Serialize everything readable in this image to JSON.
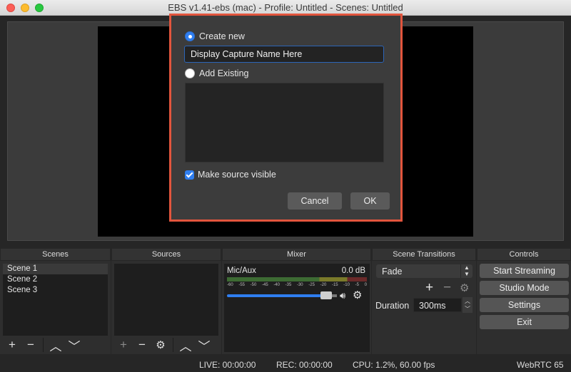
{
  "window": {
    "title": "EBS v1.41-ebs (mac) - Profile: Untitled - Scenes: Untitled"
  },
  "dialog": {
    "create_new_label": "Create new",
    "name_value": "Display Capture Name Here",
    "add_existing_label": "Add Existing",
    "make_visible_label": "Make source visible",
    "cancel_label": "Cancel",
    "ok_label": "OK"
  },
  "docks": {
    "scenes": "Scenes",
    "sources": "Sources",
    "mixer": "Mixer",
    "transitions": "Scene Transitions",
    "controls": "Controls"
  },
  "scenes": {
    "items": [
      "Scene 1",
      "Scene 2",
      "Scene 3"
    ]
  },
  "mixer": {
    "channel_name": "Mic/Aux",
    "channel_db": "0.0 dB",
    "ticks": [
      "-60",
      "-55",
      "-50",
      "-45",
      "-40",
      "-35",
      "-30",
      "-25",
      "-20",
      "-15",
      "-10",
      "-5",
      "0"
    ],
    "volume_fraction": 0.9
  },
  "transitions": {
    "selected": "Fade",
    "duration_label": "Duration",
    "duration_value": "300ms"
  },
  "controls": {
    "start_streaming": "Start Streaming",
    "studio_mode": "Studio Mode",
    "settings": "Settings",
    "exit": "Exit"
  },
  "status": {
    "live": "LIVE: 00:00:00",
    "rec": "REC: 00:00:00",
    "cpu": "CPU: 1.2%, 60.00 fps",
    "webrtc": "WebRTC 65"
  },
  "colors": {
    "accent": "#2f7ef0",
    "dialog_border": "#e2553d"
  }
}
